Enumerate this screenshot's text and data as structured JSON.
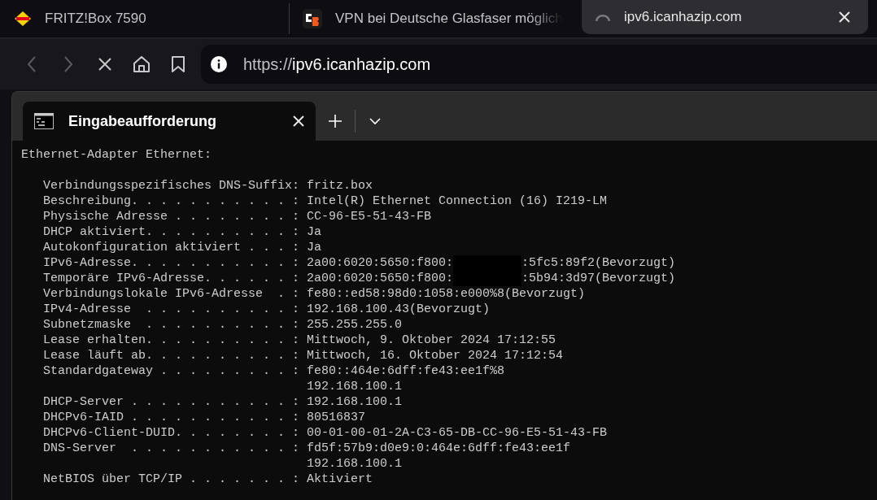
{
  "browser": {
    "tabs": [
      {
        "title": "FRITZ!Box 7590",
        "kind": "fritz",
        "selected": false,
        "loading": false
      },
      {
        "title": "VPN bei Deutsche Glasfaser möglich",
        "kind": "cb",
        "selected": false,
        "loading": false
      },
      {
        "title": "ipv6.icanhazip.com",
        "selected": true,
        "loading": true
      }
    ],
    "buttons": [
      {
        "kind": "back",
        "disabled": true
      },
      {
        "kind": "forward",
        "disabled": true
      },
      {
        "kind": "stop",
        "disabled": false
      },
      {
        "kind": "home",
        "disabled": false
      },
      {
        "kind": "bookmark",
        "disabled": false
      }
    ],
    "address_bar": {
      "scheme": "https://",
      "host": "ipv6.icanhazip.com"
    }
  },
  "terminal": {
    "tabs": [
      {
        "title": "Eingabeaufforderung",
        "selected": true
      }
    ],
    "heading": "Ethernet-Adapter Ethernet:",
    "lines": [
      {
        "label": "Verbindungsspezifisches DNS-Suffix:",
        "value": "fritz.box"
      },
      {
        "label": "Beschreibung. . . . . . . . . . . :",
        "value": "Intel(R) Ethernet Connection (16) I219-LM"
      },
      {
        "label": "Physische Adresse . . . . . . . . :",
        "value": "CC-96-E5-51-43-FB"
      },
      {
        "label": "DHCP aktiviert. . . . . . . . . . :",
        "value": "Ja"
      },
      {
        "label": "Autokonfiguration aktiviert . . . :",
        "value": "Ja"
      },
      {
        "label": "IPv6-Adresse. . . . . . . . . . . :",
        "value_parts": [
          "2a00:6020:5650:f800:",
          ":5fc5:89f2(Bevorzugt)"
        ],
        "redacted": true
      },
      {
        "label": "Temporäre IPv6-Adresse. . . . . . :",
        "value_parts": [
          "2a00:6020:5650:f800:",
          ":5b94:3d97(Bevorzugt)"
        ],
        "redacted": true
      },
      {
        "label": "Verbindungslokale IPv6-Adresse  . :",
        "value": "fe80::ed58:98d0:1058:e000%8(Bevorzugt)"
      },
      {
        "label": "IPv4-Adresse  . . . . . . . . . . :",
        "value": "192.168.100.43(Bevorzugt)"
      },
      {
        "label": "Subnetzmaske  . . . . . . . . . . :",
        "value": "255.255.255.0"
      },
      {
        "label": "Lease erhalten. . . . . . . . . . :",
        "value": "Mittwoch, 9. Oktober 2024 17:12:55"
      },
      {
        "label": "Lease läuft ab. . . . . . . . . . :",
        "value": "Mittwoch, 16. Oktober 2024 17:12:54"
      },
      {
        "label": "Standardgateway . . . . . . . . . :",
        "value": "fe80::464e:6dff:fe43:ee1f%8"
      },
      {
        "value": "192.168.100.1"
      },
      {
        "label": "DHCP-Server . . . . . . . . . . . :",
        "value": "192.168.100.1"
      },
      {
        "label": "DHCPv6-IAID . . . . . . . . . . . :",
        "value": "80516837"
      },
      {
        "label": "DHCPv6-Client-DUID. . . . . . . . :",
        "value": "00-01-00-01-2A-C3-65-DB-CC-96-E5-51-43-FB"
      },
      {
        "label": "DNS-Server  . . . . . . . . . . . :",
        "value": "fd5f:57b9:d0e9:0:464e:6dff:fe43:ee1f"
      },
      {
        "value": "192.168.100.1"
      },
      {
        "label": "NetBIOS über TCP/IP . . . . . . . :",
        "value": "Aktiviert"
      }
    ]
  }
}
